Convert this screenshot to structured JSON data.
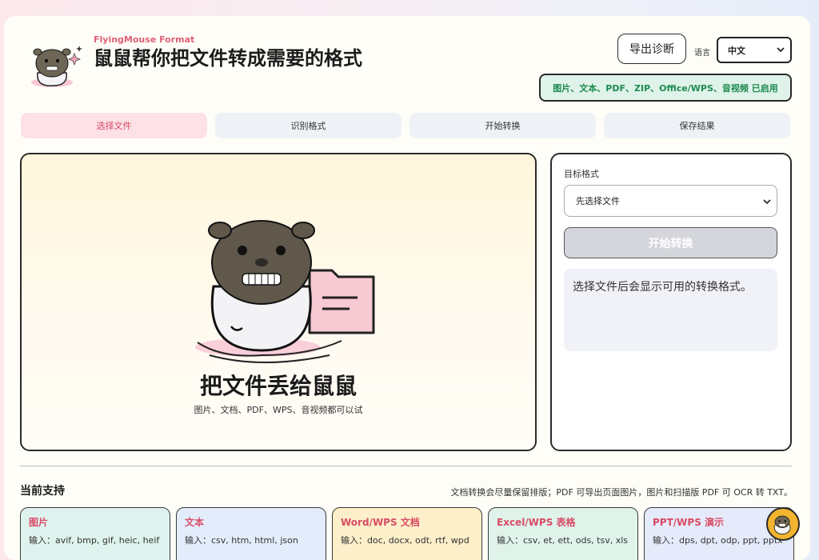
{
  "header": {
    "brand": "FlyingMouse Format",
    "title": "鼠鼠帮你把文件转成需要的格式",
    "diagnostics_button": "导出诊断",
    "language_label": "语言",
    "language_value": "中文",
    "enabled_status": "图片、文本、PDF、ZIP、Office/WPS、音视频 已启用"
  },
  "steps": [
    {
      "label": "选择文件",
      "active": true
    },
    {
      "label": "识别格式",
      "active": false
    },
    {
      "label": "开始转换",
      "active": false
    },
    {
      "label": "保存结果",
      "active": false
    }
  ],
  "dropzone": {
    "title": "把文件丢给鼠鼠",
    "subtitle": "图片、文档、PDF、WPS、音视频都可以试"
  },
  "side": {
    "target_label": "目标格式",
    "target_select_value": "先选择文件",
    "start_button": "开始转换",
    "hint": "选择文件后会显示可用的转换格式。"
  },
  "support": {
    "title": "当前支持",
    "note": "文档转换会尽量保留排版；PDF 可导出页面图片，图片和扫描版 PDF 可 OCR 转 TXT。",
    "cards": [
      {
        "title": "图片",
        "input": "输入：avif, bmp, gif, heic, heif",
        "bg": "#dff3ee"
      },
      {
        "title": "文本",
        "input": "输入：csv, htm, html, json",
        "bg": "#e3ecfb"
      },
      {
        "title": "Word/WPS 文档",
        "input": "输入：doc, docx, odt, rtf, wpd",
        "bg": "#fcefc9"
      },
      {
        "title": "Excel/WPS 表格",
        "input": "输入：csv, et, ett, ods, tsv, xls",
        "bg": "#dff3ea"
      },
      {
        "title": "PPT/WPS 演示",
        "input": "输入：dps, dpt, odp, ppt, pptx",
        "bg": "#e6ebfb"
      }
    ]
  },
  "colors": {
    "accent": "#d84c66",
    "success": "#1e8a4f",
    "fab": "#f3b52f"
  }
}
